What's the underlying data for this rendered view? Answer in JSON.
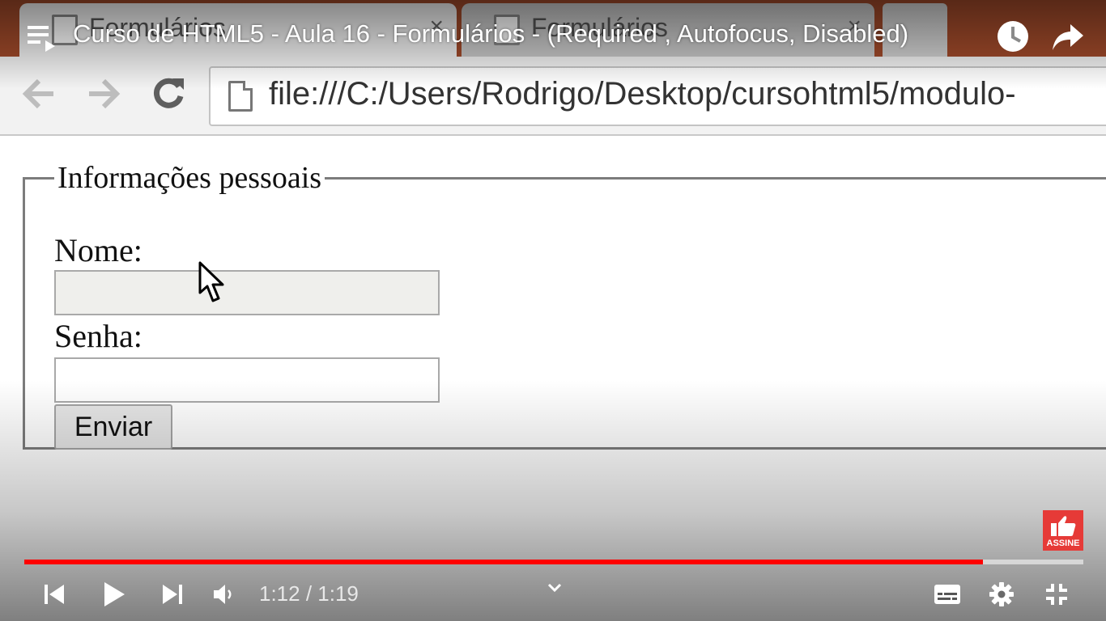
{
  "browser": {
    "tabs": [
      {
        "label": "Formulários",
        "close": "×"
      },
      {
        "label": "Formulários",
        "close": "×"
      }
    ],
    "url": "file:///C:/Users/Rodrigo/Desktop/cursohtml5/modulo-"
  },
  "form": {
    "legend": "Informações pessoais",
    "nome_label": "Nome:",
    "nome_value": "",
    "senha_label": "Senha:",
    "senha_value": "",
    "submit_label": "Enviar"
  },
  "player": {
    "title": "Curso de HTML5 - Aula 16 - Formulários - (Required , Autofocus, Disabled)",
    "time": "1:12 / 1:19",
    "progress_fraction": 0.905,
    "progress_color": "#ff0000",
    "subscribe_label": "ASSINE",
    "icons": [
      "playlist-icon",
      "watch-later-icon",
      "share-icon",
      "previous-icon",
      "play-icon",
      "next-icon",
      "volume-icon",
      "chevron-down-icon",
      "subtitles-icon",
      "settings-icon",
      "exit-fullscreen-icon"
    ]
  }
}
